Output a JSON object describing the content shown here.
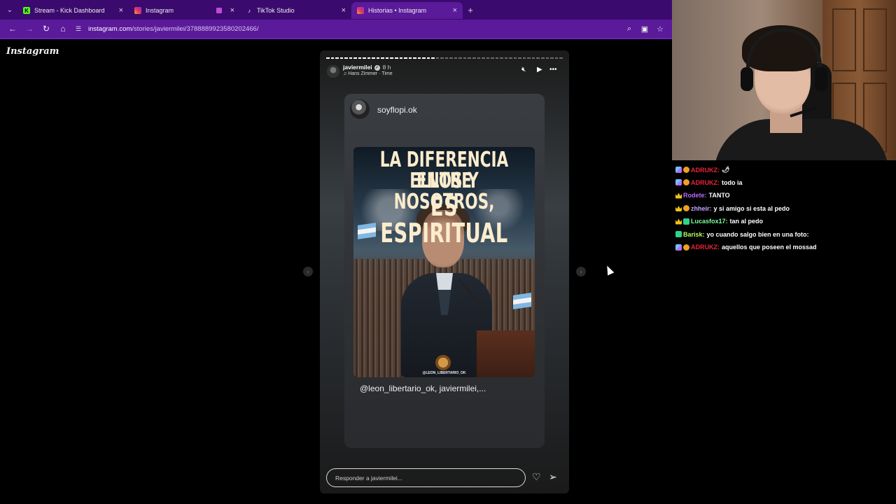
{
  "browser": {
    "tabs": [
      {
        "title": "Stream - Kick Dashboard",
        "favicon": "kick-icon",
        "active": false
      },
      {
        "title": "Instagram",
        "favicon": "instagram-icon",
        "active": false
      },
      {
        "title": "TikTok Studio",
        "favicon": "tiktok-icon",
        "active": false
      },
      {
        "title": "Historias • Instagram",
        "favicon": "instagram-icon",
        "active": true
      }
    ],
    "url_host": "instagram.com",
    "url_path": "/stories/javiermilei/3788889923580202466/",
    "colors": {
      "tabbar": "#3b0a6e",
      "toolbar": "#5a1a9a"
    }
  },
  "instagram": {
    "logo": "Instagram",
    "story": {
      "username": "javiermilei",
      "age": "8 h",
      "music": "Hans Zimmer · Time",
      "progress_segments_done": 24,
      "progress_segments_total": 52,
      "post_username": "soyflopi.ok",
      "headline": [
        "LA DIFERENCIA ENTRE",
        "ELLOS Y NOSOTROS,",
        "ES ESPIRITUAL"
      ],
      "image_credit": "@LEON_LIBERTARIO_OK",
      "caption": "@leon_libertario_ok, javiermilei,..."
    },
    "reply_placeholder": "Responder a javiermilei..."
  },
  "chat": {
    "messages": [
      {
        "badges": [
          "sword",
          "gift"
        ],
        "user": "ADRUKZ",
        "color": "#e8233a",
        "text": "🌶"
      },
      {
        "badges": [
          "sword",
          "gift"
        ],
        "user": "ADRUKZ",
        "color": "#e8233a",
        "text": "todo ia"
      },
      {
        "badges": [
          "crown"
        ],
        "user": "Rodete",
        "color": "#b76cff",
        "text": "TANTO"
      },
      {
        "badges": [
          "crown",
          "gift"
        ],
        "user": "zhheir",
        "color": "#c7a6ff",
        "text": "y si amigo si esta al pedo"
      },
      {
        "badges": [
          "crown",
          "sub"
        ],
        "user": "Lucasfox17",
        "color": "#7dff9a",
        "text": "tan al pedo"
      },
      {
        "badges": [
          "sub"
        ],
        "user": "Barisk",
        "color": "#b6ff5a",
        "text": "yo cuando salgo bien en una foto:"
      },
      {
        "badges": [
          "sword",
          "gift"
        ],
        "user": "ADRUKZ",
        "color": "#e8233a",
        "text": "aquellos que poseen el mossad"
      }
    ]
  }
}
